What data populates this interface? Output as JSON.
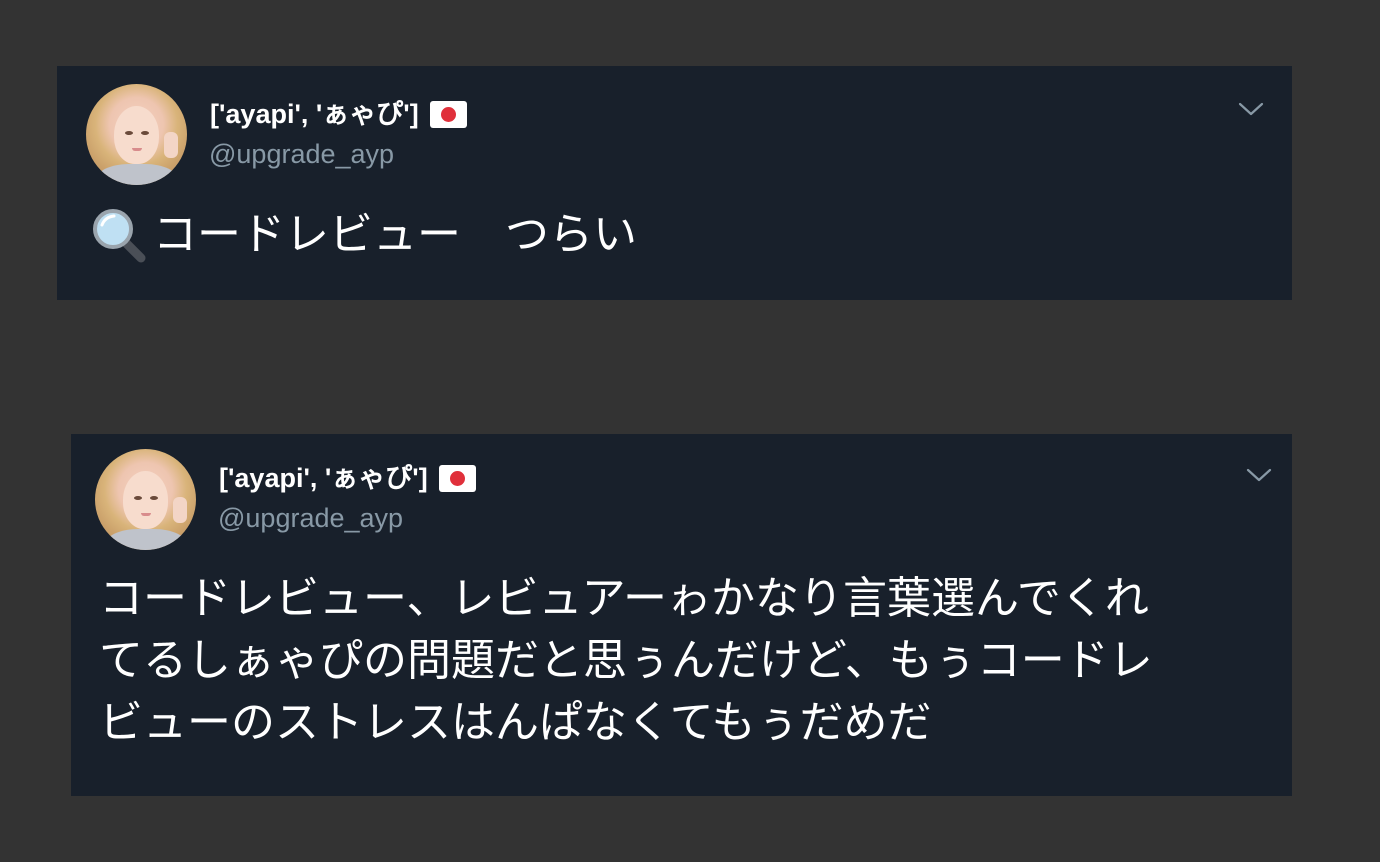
{
  "tweets": [
    {
      "display_name": "['ayapi', 'ぁゃぴ']",
      "flag_icon": "japan-flag",
      "handle": "@upgrade_ayp",
      "menu_icon": "chevron-down",
      "leading_emoji": "magnifying-glass",
      "text": "コードレビュー　つらい"
    },
    {
      "display_name": "['ayapi', 'ぁゃぴ']",
      "flag_icon": "japan-flag",
      "handle": "@upgrade_ayp",
      "menu_icon": "chevron-down",
      "text_lines": [
        "コードレビュー、レビュアーゎかなり言葉選んでくれ",
        "てるしぁゃぴの問題だと思ぅんだけど、もぅコードレ",
        "ビューのストレスはんぱなくてもぅだめだ"
      ]
    }
  ],
  "colors": {
    "background": "#333333",
    "card": "#18202b",
    "name": "#ffffff",
    "handle": "#8899a6",
    "flag_red": "#e0303b"
  }
}
